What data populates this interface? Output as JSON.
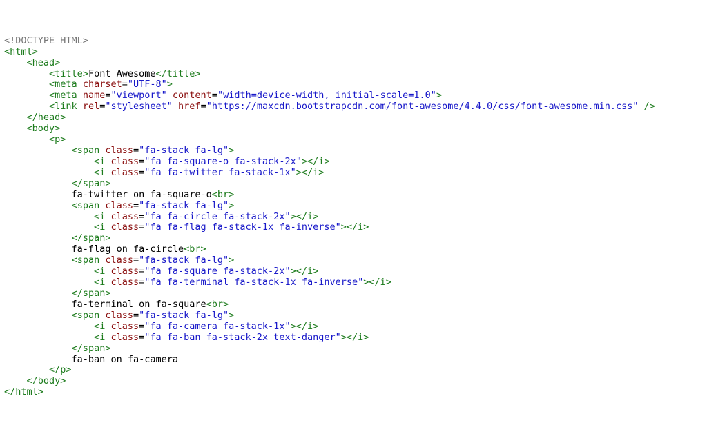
{
  "doctype": "<!DOCTYPE HTML>",
  "open_html": "<html>",
  "close_html": "</html>",
  "open_head": "<head>",
  "close_head": "</head>",
  "open_body": "<body>",
  "close_body": "</body>",
  "open_p": "<p>",
  "close_p": "</p>",
  "lt": "<",
  "gt": ">",
  "gt_slash": " />",
  "ct": "</",
  "sp": " ",
  "eq": "=",
  "tag": {
    "title": "title",
    "title_c": "/title",
    "meta": "meta",
    "link": "link",
    "span": "span",
    "span_c": "/span",
    "i": "i",
    "i_c": "/i",
    "br": "br"
  },
  "attr": {
    "charset": "charset",
    "name": "name",
    "content": "content",
    "rel": "rel",
    "href": "href",
    "class": "class"
  },
  "title_text": "Font Awesome",
  "meta_charset_val": "\"UTF-8\"",
  "meta_name_val": "\"viewport\"",
  "meta_content_val": "\"width=device-width, initial-scale=1.0\"",
  "link_rel_val": "\"stylesheet\"",
  "link_href_val": "\"https://maxcdn.bootstrapcdn.com/font-awesome/4.4.0/css/font-awesome.min.css\"",
  "c": {
    "stack_lg": "\"fa-stack fa-lg\"",
    "square_o_2x": "\"fa fa-square-o fa-stack-2x\"",
    "twitter_1x": "\"fa fa-twitter fa-stack-1x\"",
    "circle_2x": "\"fa fa-circle fa-stack-2x\"",
    "flag_1x_inv": "\"fa fa-flag fa-stack-1x fa-inverse\"",
    "square_2x": "\"fa fa-square fa-stack-2x\"",
    "terminal_1x_inv": "\"fa fa-terminal fa-stack-1x fa-inverse\"",
    "camera_1x": "\"fa fa-camera fa-stack-1x\"",
    "ban_2x_danger": "\"fa fa-ban fa-stack-2x text-danger\""
  },
  "text": {
    "twitter": "fa-twitter on fa-square-o",
    "flag": "fa-flag on fa-circle",
    "terminal": "fa-terminal on fa-square",
    "ban": "fa-ban on fa-camera"
  }
}
